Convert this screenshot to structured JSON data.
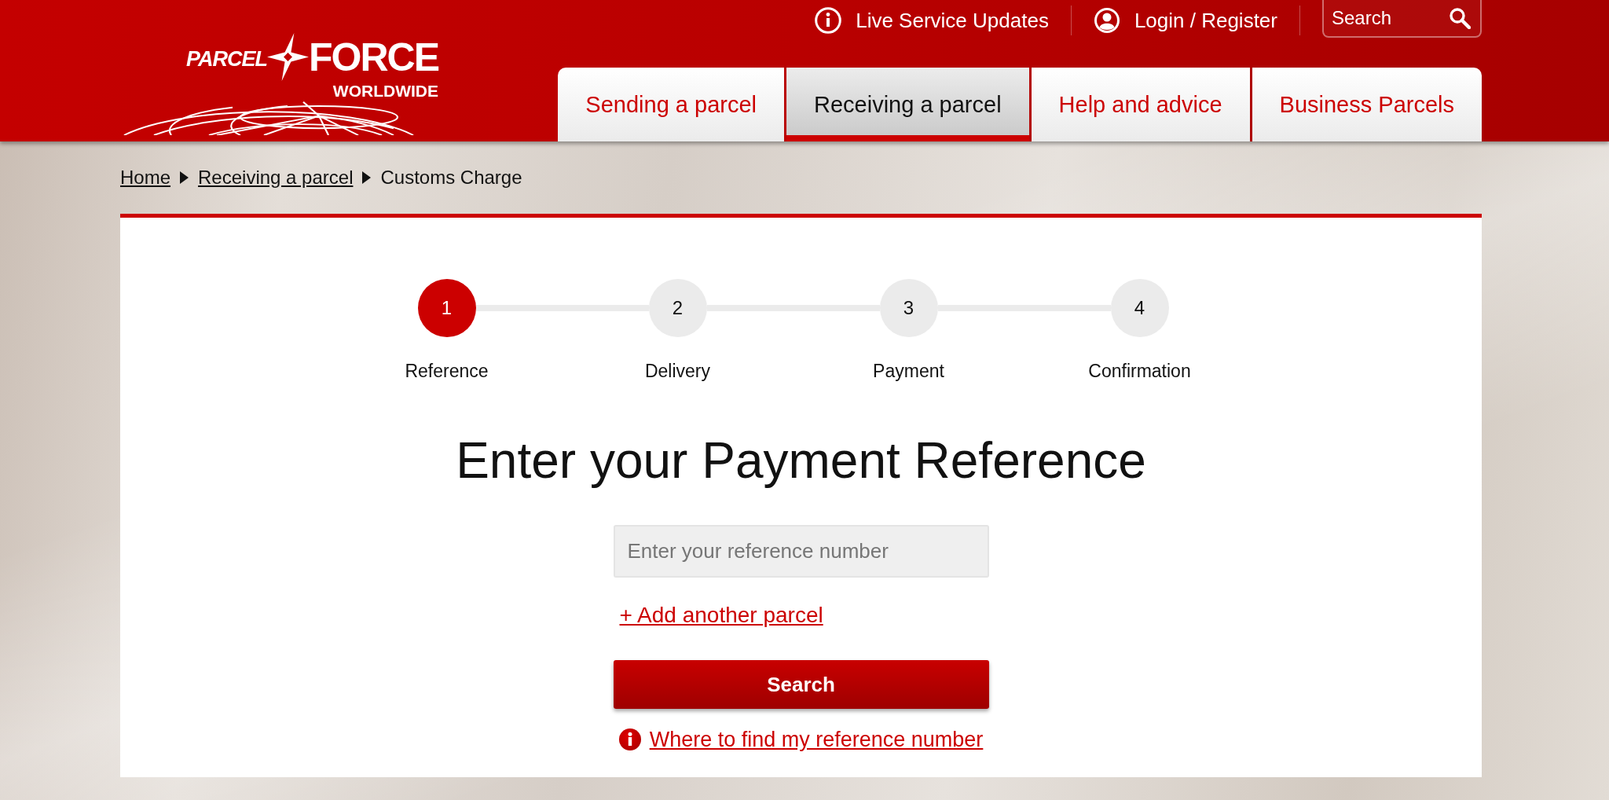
{
  "header": {
    "logo": {
      "name_part_1": "PARCEL",
      "name_part_2": "FORCE",
      "tagline": "WORLDWIDE"
    },
    "utility_links": [
      {
        "kind": "info",
        "label": "Live Service Updates"
      },
      {
        "kind": "account",
        "label": "Login / Register"
      }
    ],
    "search": {
      "placeholder": "Search"
    },
    "nav_tabs": [
      {
        "label": "Sending a parcel",
        "selected": false
      },
      {
        "label": "Receiving a parcel",
        "selected": true
      },
      {
        "label": "Help and advice",
        "selected": false
      },
      {
        "label": "Business Parcels",
        "selected": false
      }
    ]
  },
  "breadcrumb": [
    {
      "label": "Home",
      "current": false
    },
    {
      "label": "Receiving a parcel",
      "current": false
    },
    {
      "label": "Customs Charge",
      "current": true
    }
  ],
  "steps": [
    {
      "number": "1",
      "label": "Reference",
      "active": true
    },
    {
      "number": "2",
      "label": "Delivery",
      "active": false
    },
    {
      "number": "3",
      "label": "Payment",
      "active": false
    },
    {
      "number": "4",
      "label": "Confirmation",
      "active": false
    }
  ],
  "form": {
    "heading": "Enter your Payment Reference",
    "reference_field": {
      "placeholder": "Enter your reference number"
    },
    "add_link": "+ Add another parcel",
    "submit_button": "Search",
    "help_link": "Where to find my reference number"
  }
}
